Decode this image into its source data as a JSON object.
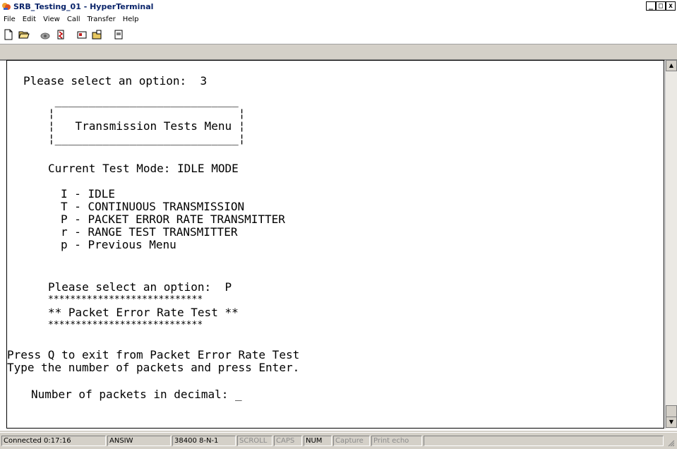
{
  "window": {
    "title": "SRB_Testing_01 - HyperTerminal",
    "minimize": "_",
    "maximize": "□",
    "close": "x"
  },
  "menu": [
    "File",
    "Edit",
    "View",
    "Call",
    "Transfer",
    "Help"
  ],
  "toolbar": {
    "icons": [
      "new-connection-icon",
      "open-icon",
      "dial-icon",
      "disconnect-icon",
      "send-icon",
      "receive-icon",
      "properties-icon"
    ]
  },
  "terminal": {
    "lines": [
      "Please select an option:  3",
      " ___________________________",
      "¦                           ¦",
      "¦   Transmission Tests Menu ¦",
      "¦___________________________¦",
      "Current Test Mode: IDLE MODE",
      "I - IDLE",
      "T - CONTINUOUS TRANSMISSION",
      "P - PACKET ERROR RATE TRANSMITTER",
      "r - RANGE TEST TRANSMITTER",
      "p - Previous Menu",
      "Please select an option:  P",
      "****************************",
      "** Packet Error Rate Test **",
      "****************************",
      "Press Q to exit from Packet Error Rate Test",
      "Type the number of packets and press Enter.",
      "Number of packets in decimal: _"
    ]
  },
  "statusbar": {
    "connected": "Connected 0:17:16",
    "emulation": "ANSIW",
    "port": "38400 8-N-1",
    "scroll": "SCROLL",
    "caps": "CAPS",
    "num": "NUM",
    "capture": "Capture",
    "print_echo": "Print echo"
  }
}
